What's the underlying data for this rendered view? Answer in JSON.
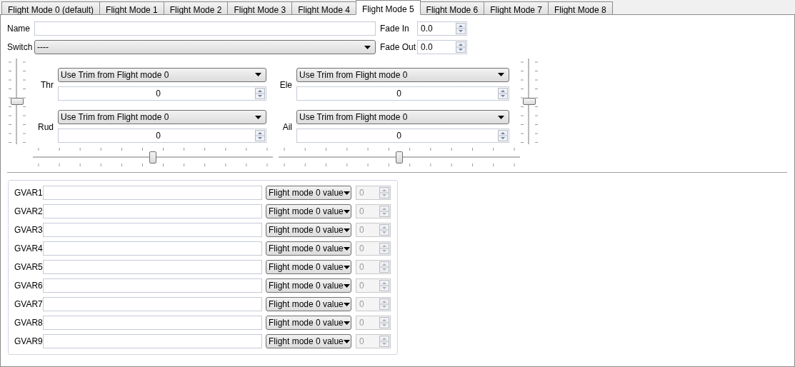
{
  "tabs": [
    {
      "label": "Flight Mode 0 (default)",
      "selected": false
    },
    {
      "label": "Flight Mode 1",
      "selected": false
    },
    {
      "label": "Flight Mode 2",
      "selected": false
    },
    {
      "label": "Flight Mode 3",
      "selected": false
    },
    {
      "label": "Flight Mode 4",
      "selected": false
    },
    {
      "label": "Flight Mode 5",
      "selected": true
    },
    {
      "label": "Flight Mode 6",
      "selected": false
    },
    {
      "label": "Flight Mode 7",
      "selected": false
    },
    {
      "label": "Flight Mode 8",
      "selected": false
    }
  ],
  "name": {
    "label": "Name"
  },
  "fade_in": {
    "label": "Fade In",
    "value": "0.0"
  },
  "switch": {
    "label": "Switch",
    "value": "----"
  },
  "fade_out": {
    "label": "Fade Out",
    "value": "0.0"
  },
  "trims": [
    {
      "label": "Thr",
      "source": "Use Trim from Flight mode 0",
      "value": "0"
    },
    {
      "label": "Ele",
      "source": "Use Trim from Flight mode 0",
      "value": "0"
    },
    {
      "label": "Rud",
      "source": "Use Trim from Flight mode 0",
      "value": "0"
    },
    {
      "label": "Ail",
      "source": "Use Trim from Flight mode 0",
      "value": "0"
    }
  ],
  "sliders": {
    "vertical_left": {
      "level": 0.5
    },
    "vertical_right": {
      "level": 0.5
    },
    "horizontal_left": {
      "level": 0.5
    },
    "horizontal_right": {
      "level": 0.5
    }
  },
  "gvars": [
    {
      "label": "GVAR1",
      "mode": "Flight mode 0 value",
      "value": "0",
      "disabled": true
    },
    {
      "label": "GVAR2",
      "mode": "Flight mode 0 value",
      "value": "0",
      "disabled": true
    },
    {
      "label": "GVAR3",
      "mode": "Flight mode 0 value",
      "value": "0",
      "disabled": true
    },
    {
      "label": "GVAR4",
      "mode": "Flight mode 0 value",
      "value": "0",
      "disabled": true
    },
    {
      "label": "GVAR5",
      "mode": "Flight mode 0 value",
      "value": "0",
      "disabled": true
    },
    {
      "label": "GVAR6",
      "mode": "Flight mode 0 value",
      "value": "0",
      "disabled": true
    },
    {
      "label": "GVAR7",
      "mode": "Flight mode 0 value",
      "value": "0",
      "disabled": true
    },
    {
      "label": "GVAR8",
      "mode": "Flight mode 0 value",
      "value": "0",
      "disabled": true
    },
    {
      "label": "GVAR9",
      "mode": "Flight mode 0 value",
      "value": "0",
      "disabled": true
    }
  ]
}
